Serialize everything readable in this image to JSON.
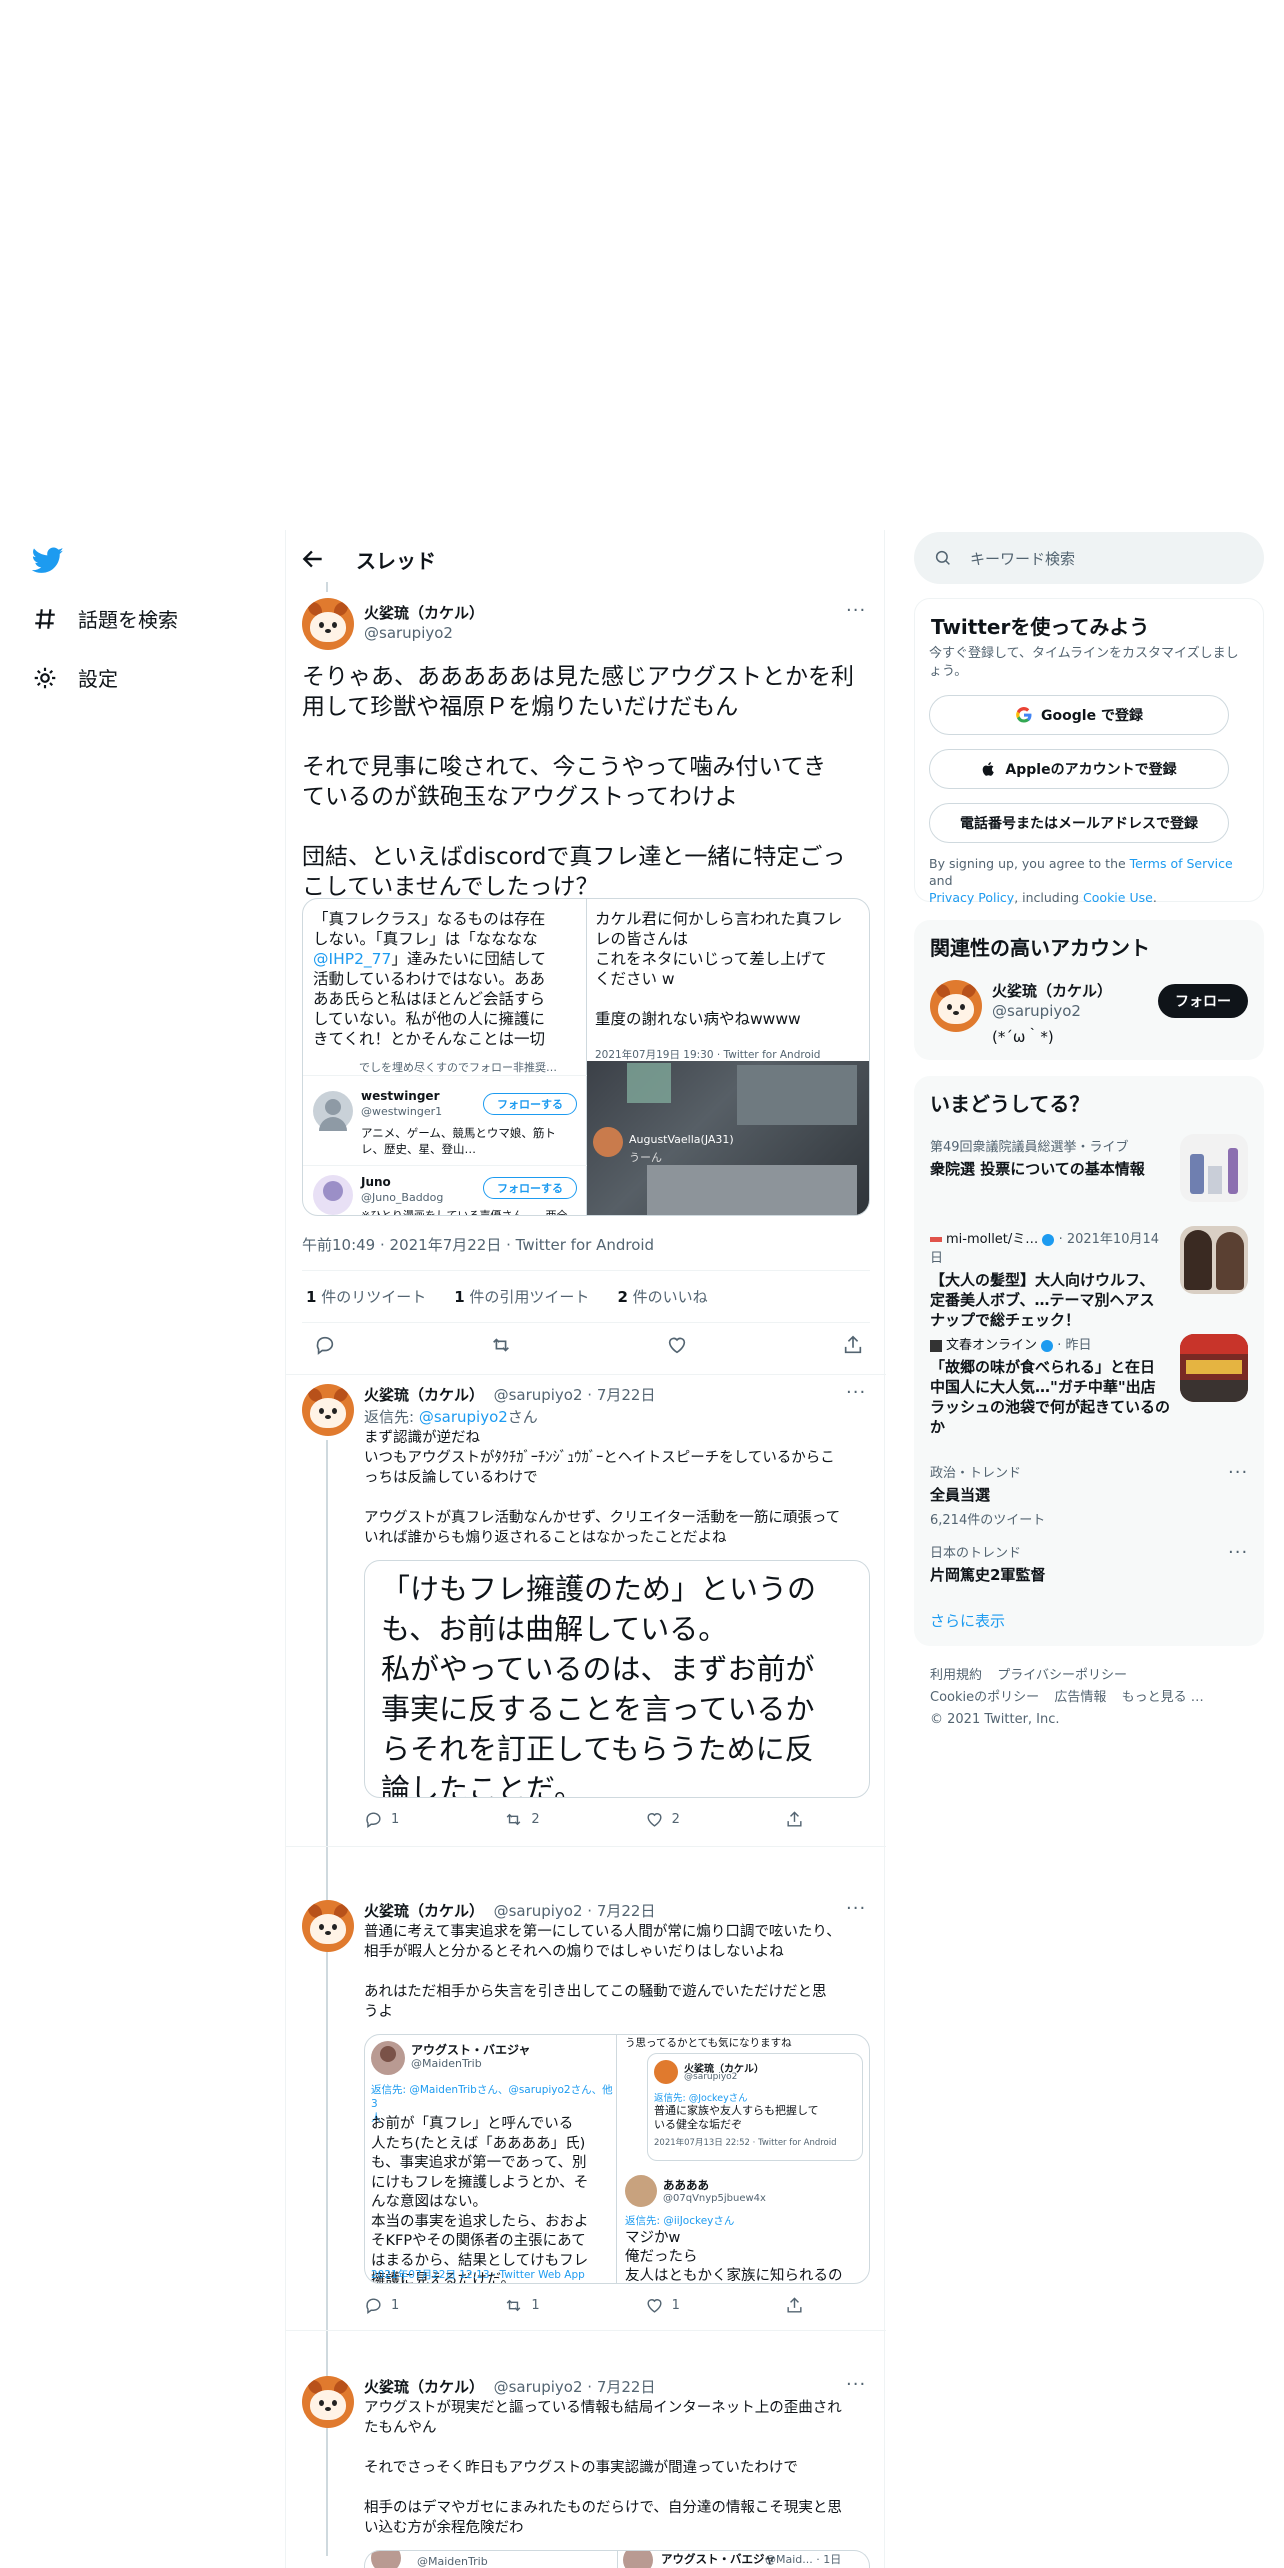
{
  "nav": {
    "items": [
      {
        "label": "話題を検索",
        "icon": "hashtag-icon"
      },
      {
        "label": "設定",
        "icon": "gear-icon"
      }
    ]
  },
  "header": {
    "title": "スレッド"
  },
  "main_tweet": {
    "name": "火娑琉（カケル）",
    "handle": "@sarupiyo2",
    "text": "そりゃあ、あああああは見た感じアウグストとかを利\n用して珍獣や福原Ｐを煽りたいだけだもん\n\nそれで見事に唆されて、今こうやって噛み付いてき\nているのが鉄砲玉なアウグストってわけよ\n\n団結、といえばdiscordで真フレ達と一緒に特定ごっ\nこしていませんでしたっけ？",
    "media_left": {
      "text_before": "「真フレクラス」なるものは存在\nしない。「真フレ」は「なななな\n",
      "mention": "@IHP2_77",
      "text_after": "」達みたいに団結して\n活動しているわけではない。ああ\nああ氏らと私はほとんど会話すら\nしていない。私が他の人に擁護に\nきてくれ！とかそんなことは一切",
      "cut_text": "でしを埋め尽くすのでフォロー非推奨…",
      "users": [
        {
          "name": "westwinger",
          "handle": "@westwinger1",
          "bio": "アニメ、ゲーム、競馬とウマ娘、筋ト\nレ、歴史、星、登山…",
          "follow": "フォローする"
        },
        {
          "name": "Juno",
          "handle": "@Juno_Baddog",
          "bio": "※ひとり漫画をしている声優さん…、两全",
          "follow": "フォローする"
        }
      ]
    },
    "media_right": {
      "text": "カケル君に何かしら言われた真フレ\nレの皆さんは\nこれをネタにいじって差し上げて\nください w\n\n重度の謝れない病やねwwww",
      "meta": "2021年07月19日 19:30 · Twitter for Android",
      "reply_name": "AugustVaella(JA31)",
      "reply_text": "うーん"
    },
    "timestamp": "午前10:49 · 2021年7月22日 · Twitter for Android",
    "stats": [
      {
        "num": "1",
        "label": " 件のリツイート"
      },
      {
        "num": "1",
        "label": " 件の引用ツイート"
      },
      {
        "num": "2",
        "label": " 件のいいね"
      }
    ]
  },
  "replies": [
    {
      "name": "火娑琉（カケル）",
      "meta": "@sarupiyo2 · 7月22日",
      "reply_to_label": "返信先: ",
      "reply_to_handle": "@sarupiyo2",
      "reply_to_suffix": "さん",
      "text": "まず認識が逆だね\nいつもアウグストがﾀｸﾁｶﾞｰﾁﾝｼﾞｭｳｶﾞｰとヘイトスピーチをしているからこ\nっちは反論しているわけで\n\nアウグストが真フレ活動なんかせず、クリエイター活動を一筋に頑張って\nいれば誰からも煽り返されることはなかったことだよね",
      "image_text": "「けもフレ擁護のため」というの\nも、お前は曲解している。\n私がやっているのは、まずお前が\n事実に反することを言っているか\nらそれを訂正してもらうために反\n論したことだ。\nただお前の煽りに対し、こちらも\n煽り返したり、暴言ともとられ",
      "counts": {
        "reply": "1",
        "retweet": "2",
        "like": "2"
      }
    },
    {
      "name": "火娑琉（カケル）",
      "meta": "@sarupiyo2 · 7月22日",
      "text": "普通に考えて事実追求を第一にしている人間が常に煽り口調で呟いたり、\n相手が暇人と分かるとそれへの煽りではしゃいだりはしないよね\n\nあれはただ相手から失言を引き出してこの騒動で遊んでいただけだと思\nうよ",
      "media_left": {
        "name": "アウグスト・バエジャ",
        "handle": "@MaidenTrib",
        "reply_to": "返信先: @MaidenTribさん、@sarupiyo2さん、他3\n人",
        "text": "お前が「真フレ」と呼んでいる\n人たち(たとえば「ああああ」氏)\nも、事実追求が第一であって、別\nにけもフレを擁護しようとか、そ\nんな意図はない。\n本当の事実を追求したら、おおよ\nそKFPやその関係者の主張にあて\nはまるから、結果としてけもフレ\n擁護に見えるだけだ。",
        "meta": "2021年07月22日 12:13 · Twitter Web App"
      },
      "media_right": {
        "top_text": "う思ってるかとても気になりますね",
        "quote_name": "火娑琉（カケル）",
        "quote_handle": "@sarupiyo2",
        "quote_reply": "返信先: @Jockeyさん",
        "quote_text": "普通に家族や友人すらも把握して\nいる健全な垢だぞ",
        "quote_meta": "2021年07月13日 22:52 · Twitter for Android",
        "name": "ああああ",
        "handle": "@07qVnyp5jbuew4x",
        "reply_to": "返信先: @iiJockeyさん",
        "text": "マジかw\n俺だったら\n友人はともかく家族に知られるの\nは嫌だなぁ…"
      },
      "counts": {
        "reply": "1",
        "retweet": "1",
        "like": "1"
      }
    },
    {
      "name": "火娑琉（カケル）",
      "meta": "@sarupiyo2 · 7月22日",
      "text": "アウグストが現実だと謳っている情報も結局インターネット上の歪曲され\nたもんやん\n\nそれでさっそく昨日もアウグストの事実認識が間違っていたわけで\n\n相手のはデマやガセにまみれたものだらけで、自分達の情報こそ現実と思\nい込む方が余程危険だわ",
      "media_left_handle": "@MaidenTrib",
      "media_right_name": "アウグスト・バエジャ",
      "media_right_meta": "@Maid... · 1日"
    }
  ],
  "search": {
    "placeholder": "キーワード検索"
  },
  "signup": {
    "title": "Twitterを使ってみよう",
    "desc": "今すぐ登録して、タイムラインをカスタマイズしましょう。",
    "google": "Google で登録",
    "apple": "Appleのアカウントで登録",
    "phone": "電話番号またはメールアドレスで登録",
    "legal_1": "By signing up, you agree to the ",
    "terms": "Terms of Service",
    "legal_2": " and",
    "privacy": "Privacy Policy",
    "legal_3": ", including ",
    "cookie": "Cookie Use",
    "legal_4": "."
  },
  "related": {
    "title": "関連性の高いアカウント",
    "name": "火娑琉（カケル）",
    "handle": "@sarupiyo2",
    "bio": "(*´ω｀*)",
    "follow": "フォロー"
  },
  "trends": {
    "title": "いまどうしてる？",
    "items": [
      {
        "meta": "第49回衆議院議員総選挙・ライブ",
        "title": "衆院選 投票についての基本情報"
      },
      {
        "source": "mi-mollet/ミ…",
        "meta": " · 2021年10月14日",
        "title": "【大人の髪型】大人向けウルフ、\n定番美人ボブ、…テーマ別ヘアス\nナップで総チェック！"
      },
      {
        "source": "文春オンライン",
        "meta": " · 昨日",
        "title": "「故郷の味が食べられる」と在日\n中国人に大人気…\"ガチ中華\"出店\nラッシュの池袋で何が起きているの\nか"
      },
      {
        "meta": "政治・トレンド",
        "title": "全員当選",
        "sub": "6,214件のツイート"
      },
      {
        "meta": "日本のトレンド",
        "title": "片岡篤史2軍監督"
      }
    ],
    "more": "さらに表示"
  },
  "footer": {
    "links": [
      "利用規約",
      "プライバシーポリシー",
      "Cookieのポリシー",
      "広告情報",
      "もっと見る …"
    ],
    "copyright": "© 2021 Twitter, Inc."
  },
  "colors": {
    "accent": "#1d9bf0",
    "text": "#0f1419",
    "muted": "#536471",
    "border": "#eff3f4"
  }
}
